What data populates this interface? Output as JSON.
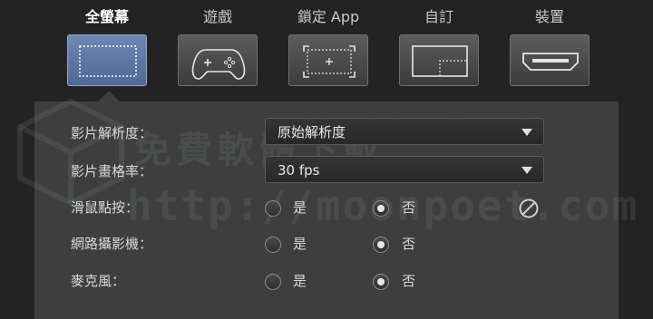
{
  "modes": [
    {
      "label": "全螢幕",
      "icon": "fullscreen-icon",
      "active": true
    },
    {
      "label": "遊戲",
      "icon": "gamepad-icon",
      "active": false
    },
    {
      "label": "鎖定 App",
      "icon": "lock-app-icon",
      "active": false
    },
    {
      "label": "自訂",
      "icon": "custom-region-icon",
      "active": false
    },
    {
      "label": "裝置",
      "icon": "hdmi-icon",
      "active": false
    }
  ],
  "settings": {
    "resolution": {
      "label": "影片解析度：",
      "value": "原始解析度"
    },
    "framerate": {
      "label": "影片畫格率：",
      "value": "30 fps"
    },
    "mouse_click": {
      "label": "滑鼠點按：",
      "yes": "是",
      "no": "否",
      "selected": "no",
      "disabled_icon": "no-symbol-icon"
    },
    "webcam": {
      "label": "網路攝影機：",
      "yes": "是",
      "no": "否",
      "selected": "no"
    },
    "microphone": {
      "label": "麥克風：",
      "yes": "是",
      "no": "否",
      "selected": "no"
    }
  },
  "watermark": {
    "line1": "免費軟體下載",
    "line2": "http://moonpoet.com"
  },
  "colors": {
    "background": "#232323",
    "panel": "#3e3e3e",
    "active_tab": "#5f78a6"
  }
}
